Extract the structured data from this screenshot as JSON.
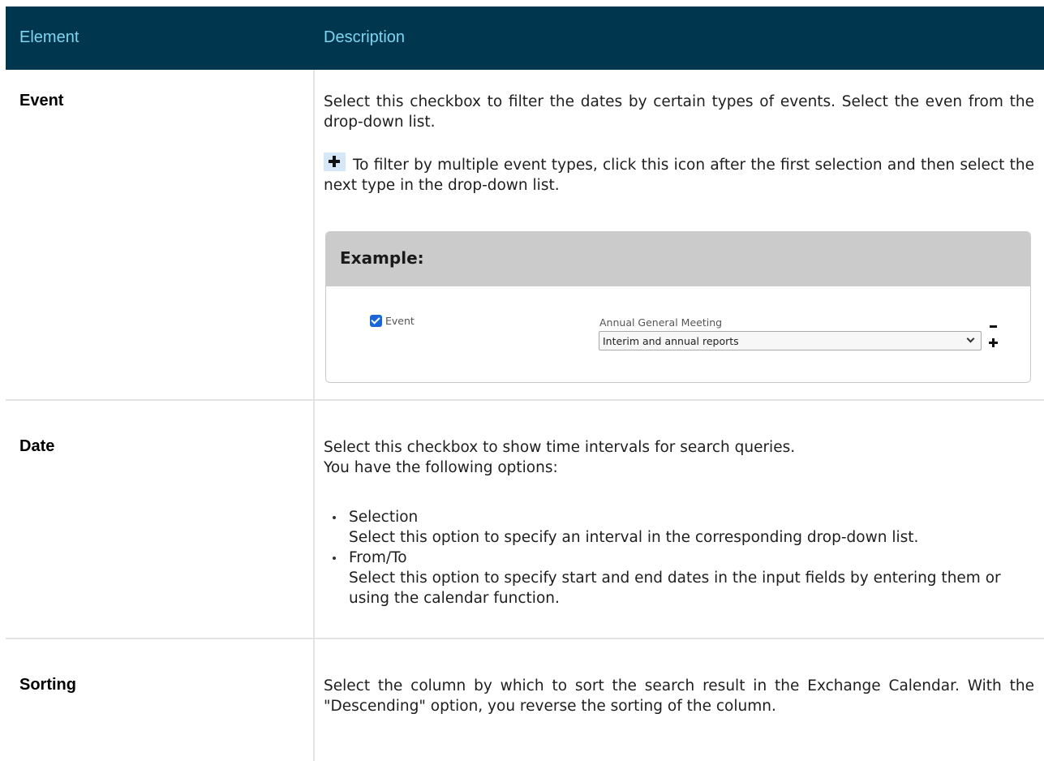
{
  "table": {
    "headers": {
      "element": "Element",
      "description": "Description"
    },
    "rows": [
      {
        "element": "Event",
        "description": "Select this checkbox to filter the dates by certain types of events. Select the even from the drop-down list.",
        "icon_text": "To filter by multiple event types, click this icon after the first selection and then select the next type in the drop-down list.",
        "icon": "plus-icon",
        "example": {
          "title": "Example:",
          "checkbox_label": "Event",
          "checkbox_checked": true,
          "meeting_text": "Annual General Meeting",
          "select_value": "Interim and annual reports"
        }
      },
      {
        "element": "Date",
        "description": "Select this checkbox to show time intervals for search queries.",
        "description2": "You have the following options:",
        "options": [
          {
            "name": "Selection",
            "text": "Select this option to specify an interval in the corresponding drop-down list."
          },
          {
            "name": "From/To",
            "text": "Select this option to specify start and end dates in the input fields by entering them or using the calendar function."
          }
        ]
      },
      {
        "element": "Sorting",
        "description": "Select the column by which to sort the search result in the Exchange Calendar. With the \"Descending\" option, you reverse the sorting of the column."
      }
    ]
  },
  "colors": {
    "header_bg": "#00374f",
    "header_text": "#7fd4f0",
    "example_head_bg": "#cbcbcb",
    "checkbox": "#1a66d8",
    "icon_bg": "#d6e8f7"
  }
}
